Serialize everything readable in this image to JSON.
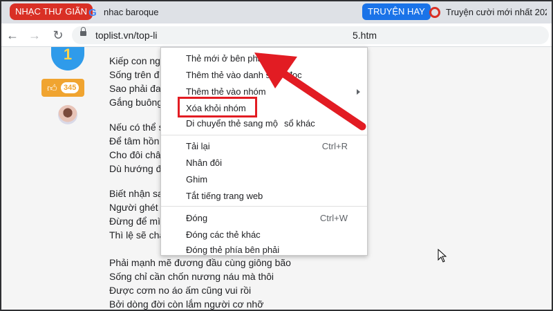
{
  "tabs": {
    "red_tab": "NHẠC THƯ GIÃN",
    "google_tab": "nhac baroque",
    "truyen_tab": "TRUYỆN HAY",
    "cuoi_tab": "Truyện cười mới nhất 202"
  },
  "toolbar": {
    "url": "toplist.vn/top-li",
    "url_tail": "5.htm"
  },
  "sidebar": {
    "rank": "1",
    "likes": "345"
  },
  "poem_lines": [
    "Kiếp con ng",
    "Sống trên đ",
    "Sao phải đa",
    "Gắng buông",
    "",
    "Nếu có thể s",
    "Để tâm hồn",
    "Cho đôi châ",
    "Dù hướng đ",
    "",
    "Biết nhận sa",
    "Người ghét",
    "Đừng để mình xem nặng nhẹ thiệt hơn",
    "Thì lệ sẽ chẳng ướt sờn vai áo",
    "",
    "Phải mạnh mẽ đương đầu cùng giông bão",
    "Sống chỉ cần chốn nương náu mà thôi",
    "Được cơm no áo ấm cũng vui rồi",
    "Bởi dòng đời còn lắm người cơ nhỡ"
  ],
  "menu": {
    "new_tab_right": "Thẻ mới ở bên phải",
    "add_reading_list": "Thêm thẻ vào danh sách đọc",
    "add_to_group": "Thêm thẻ vào nhóm",
    "remove_from_group": "Xóa khỏi nhóm",
    "move_tab": "Di chuyển thẻ sang mộ",
    "move_tab_tail": "sổ khác",
    "reload": "Tải lại",
    "reload_shortcut": "Ctrl+R",
    "duplicate": "Nhân đôi",
    "pin": "Ghim",
    "mute": "Tắt tiếng trang web",
    "close": "Đóng",
    "close_shortcut": "Ctrl+W",
    "close_others": "Đóng các thẻ khác",
    "close_right": "Đóng thẻ phía bên phải"
  },
  "colors": {
    "annotation": "#e21c23",
    "tab_red": "#d93025",
    "tab_blue": "#1a73e8"
  }
}
